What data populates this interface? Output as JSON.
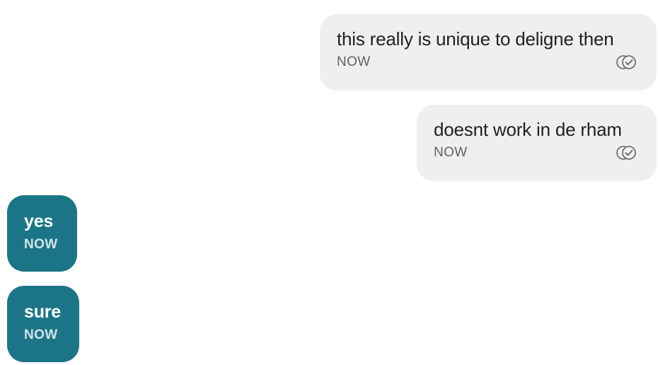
{
  "conversation": {
    "messages": [
      {
        "direction": "outgoing",
        "text": "this really is unique to deligne then",
        "time": "NOW",
        "status_icon": "read-receipt-icon"
      },
      {
        "direction": "outgoing",
        "text": "doesnt work in de rham",
        "time": "NOW",
        "status_icon": "read-receipt-icon"
      },
      {
        "direction": "incoming",
        "text": "yes",
        "time": "NOW"
      },
      {
        "direction": "incoming",
        "text": "sure",
        "time": "NOW"
      }
    ]
  },
  "colors": {
    "outgoing_bubble": "#eef0ef",
    "incoming_bubble": "#1c7587",
    "outgoing_text": "#202124",
    "incoming_text": "#ffffff",
    "timestamp_outgoing": "#5f6368",
    "timestamp_incoming": "#cfe3e8"
  }
}
